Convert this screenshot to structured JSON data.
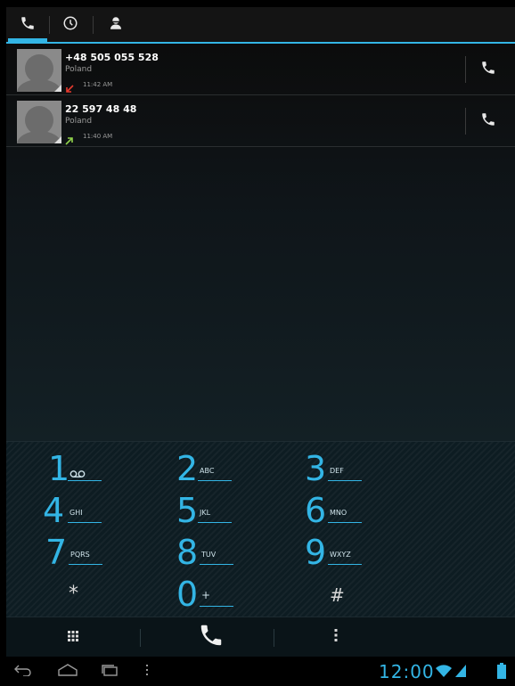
{
  "tabs": [
    {
      "name": "phone",
      "icon": "phone-icon",
      "selected": true
    },
    {
      "name": "recent",
      "icon": "clock-icon",
      "selected": false
    },
    {
      "name": "contacts",
      "icon": "person-icon",
      "selected": false
    }
  ],
  "call_log": [
    {
      "number": "+48 505 055 528",
      "location": "Poland",
      "time": "11:42 AM",
      "direction": "incoming",
      "direction_icon": "arrow-down-left-icon",
      "direction_color": "#e63a2e"
    },
    {
      "number": "22 597 48 48",
      "location": "Poland",
      "time": "11:40 AM",
      "direction": "outgoing",
      "direction_icon": "arrow-up-right-icon",
      "direction_color": "#8fd14b"
    }
  ],
  "dialpad": {
    "keys": [
      {
        "digit": "1",
        "letters": ""
      },
      {
        "digit": "2",
        "letters": "ABC"
      },
      {
        "digit": "3",
        "letters": "DEF"
      },
      {
        "digit": "4",
        "letters": "GHI"
      },
      {
        "digit": "5",
        "letters": "JKL"
      },
      {
        "digit": "6",
        "letters": "MNO"
      },
      {
        "digit": "7",
        "letters": "PQRS"
      },
      {
        "digit": "8",
        "letters": "TUV"
      },
      {
        "digit": "9",
        "letters": "WXYZ"
      },
      {
        "digit": "*",
        "letters": ""
      },
      {
        "digit": "0",
        "letters": "+"
      },
      {
        "digit": "#",
        "letters": ""
      }
    ]
  },
  "action_bar": {
    "dialpad_icon": "dialpad-icon",
    "call_icon": "phone-icon",
    "menu_icon": "overflow-menu-icon"
  },
  "status_bar": {
    "time": "12:00",
    "wifi_icon": "wifi-icon",
    "signal_icon": "signal-icon",
    "battery_icon": "battery-icon"
  },
  "colors": {
    "accent": "#33b5e5",
    "tabbar_bg": "#141414",
    "dialpad_bg": "#0d1c22"
  }
}
